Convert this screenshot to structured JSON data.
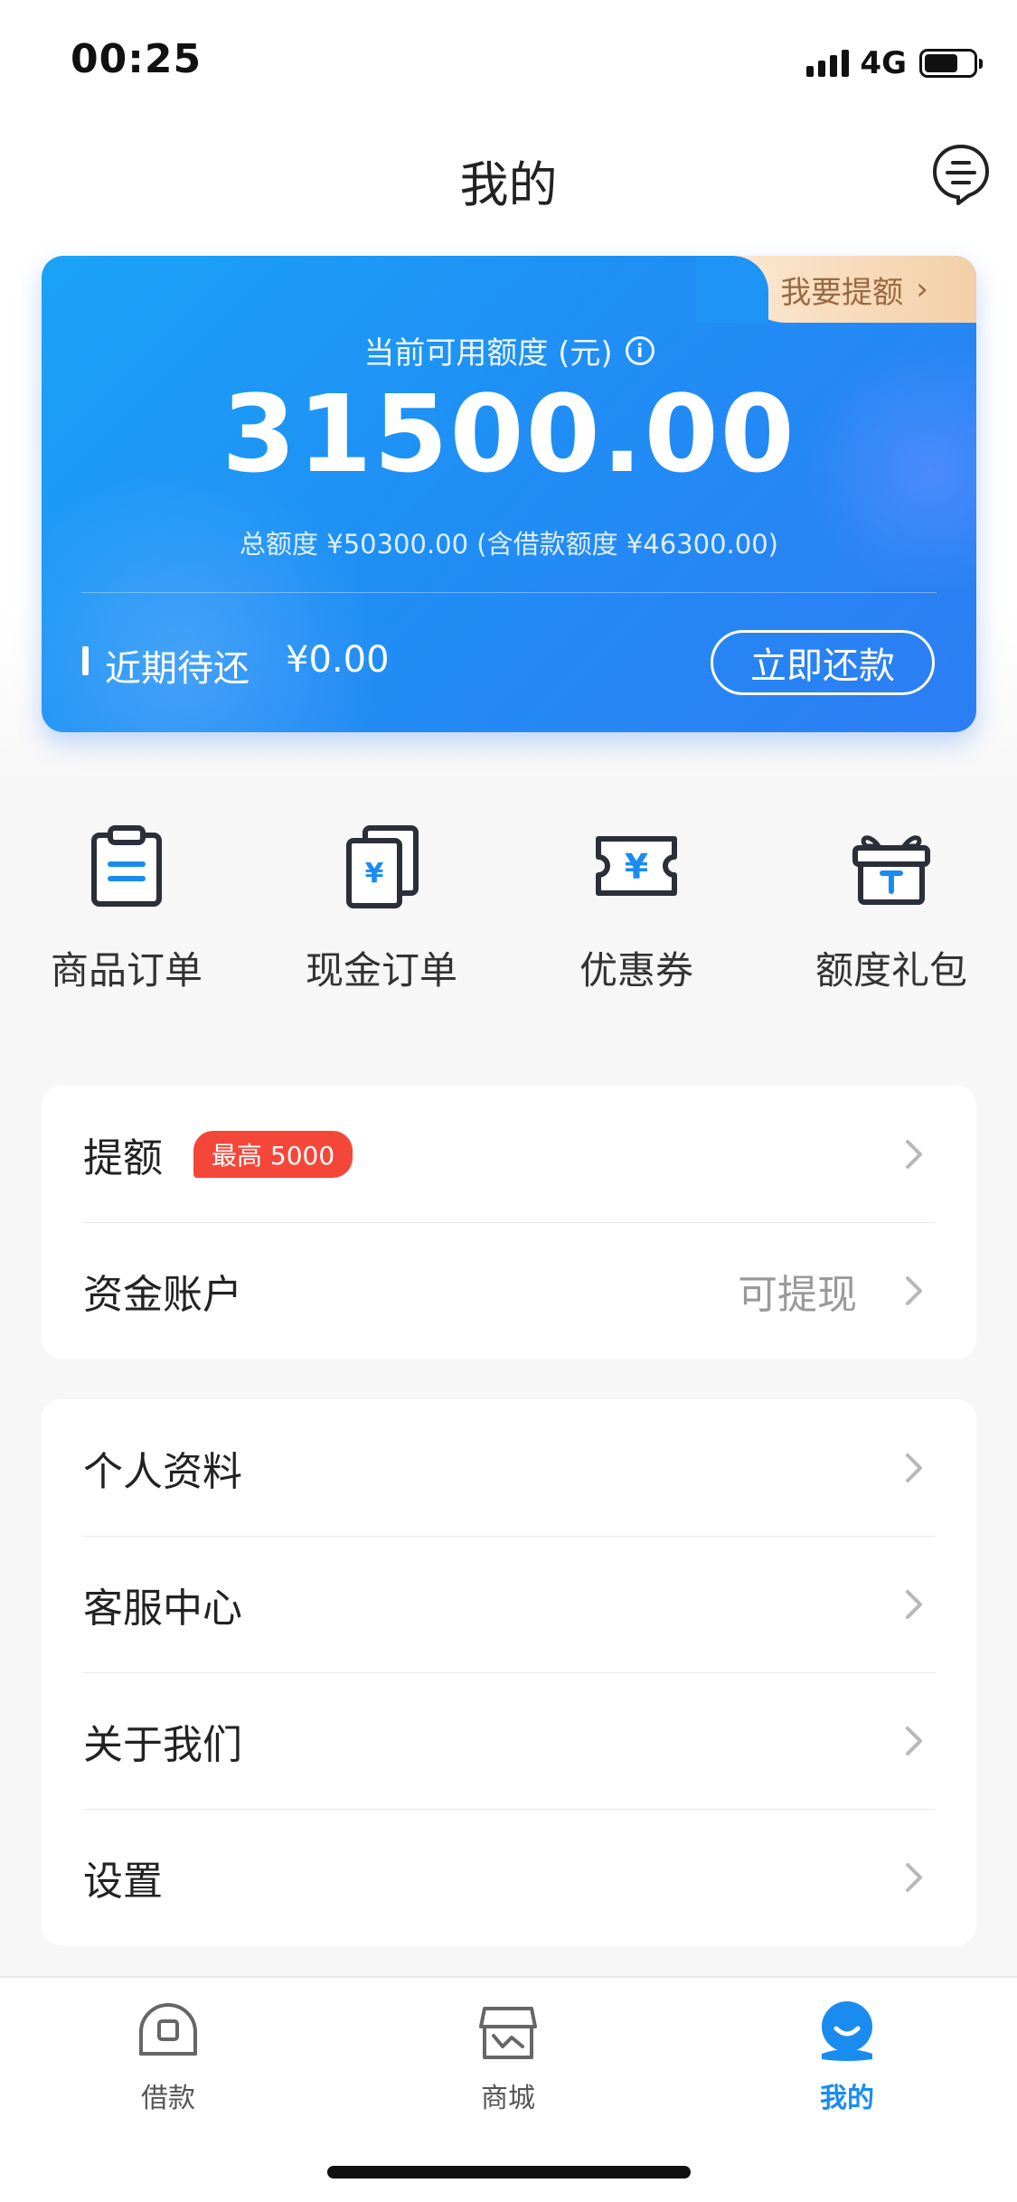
{
  "status_bar": {
    "time": "00:25",
    "network": "4G"
  },
  "header": {
    "title": "我的"
  },
  "credit_card": {
    "raise_tag": "我要提额",
    "available_label": "当前可用额度 (元)",
    "available_amount": "31500.00",
    "total_text": "总额度 ¥50300.00 (含借款额度 ¥46300.00)",
    "due_label": "近期待还",
    "due_amount": "¥0.00",
    "repay_button": "立即还款"
  },
  "quick_actions": [
    {
      "label": "商品订单",
      "icon": "clipboard-icon"
    },
    {
      "label": "现金订单",
      "icon": "cash-order-icon"
    },
    {
      "label": "优惠券",
      "icon": "coupon-icon"
    },
    {
      "label": "额度礼包",
      "icon": "gift-icon"
    }
  ],
  "panel1": [
    {
      "label": "提额",
      "badge": "最高 5000"
    },
    {
      "label": "资金账户",
      "value": "可提现"
    }
  ],
  "panel2": [
    {
      "label": "个人资料"
    },
    {
      "label": "客服中心"
    },
    {
      "label": "关于我们"
    },
    {
      "label": "设置"
    }
  ],
  "tab_bar": [
    {
      "label": "借款",
      "icon": "loan-icon",
      "active": false
    },
    {
      "label": "商城",
      "icon": "store-icon",
      "active": false
    },
    {
      "label": "我的",
      "icon": "profile-icon",
      "active": true
    }
  ],
  "colors": {
    "accent": "#1a8cf0",
    "badge": "#f4473a",
    "card_gradient_start": "#1aa3f7",
    "card_gradient_end": "#2d7df4",
    "tag_gold": "#f3cfa8"
  }
}
